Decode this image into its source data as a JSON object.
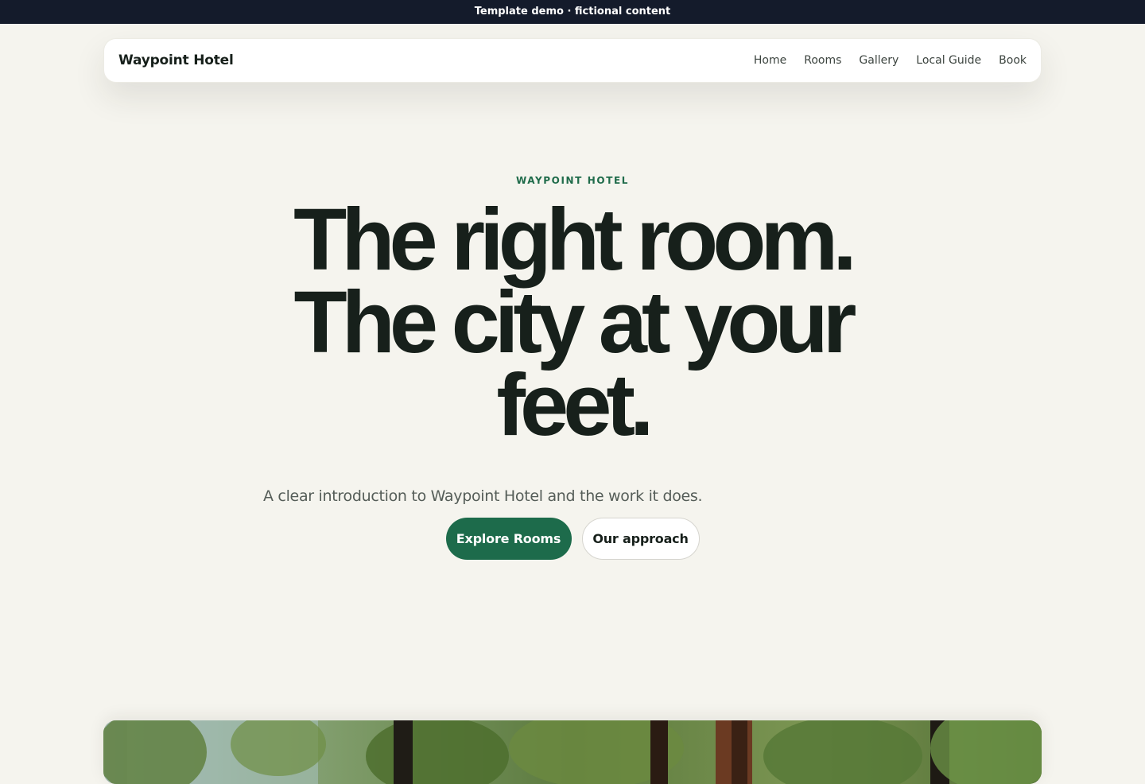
{
  "banner": {
    "text": "Template demo · fictional content"
  },
  "nav": {
    "brand": "Waypoint Hotel",
    "links": [
      {
        "label": "Home"
      },
      {
        "label": "Rooms"
      },
      {
        "label": "Gallery"
      },
      {
        "label": "Local Guide"
      },
      {
        "label": "Book"
      }
    ]
  },
  "hero": {
    "eyebrow": "WAYPOINT HOTEL",
    "headline_line1": "The right room.",
    "headline_line2": "The city at your",
    "headline_line3": "feet.",
    "subtitle": "A clear introduction to Waypoint Hotel and the work it does.",
    "primary_cta": "Explore Rooms",
    "secondary_cta": "Our approach"
  },
  "colors": {
    "background": "#f5f4ee",
    "accent": "#1d6b4b",
    "banner": "#141b2b",
    "text": "#17201b"
  }
}
